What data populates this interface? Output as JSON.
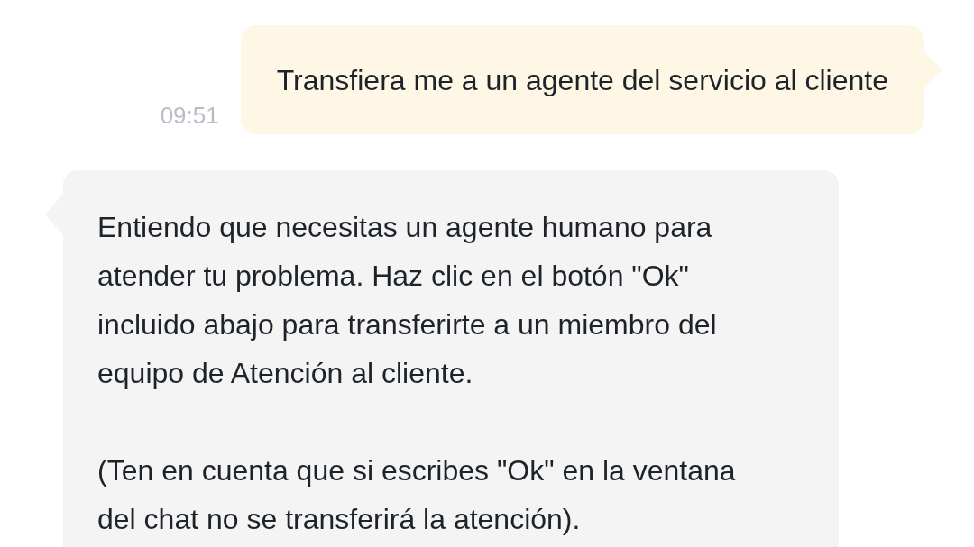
{
  "messages": [
    {
      "kind": "outgoing",
      "time": "09:51",
      "paragraphs": [
        [
          "Transfiera me a un agente del servicio al cliente"
        ]
      ]
    },
    {
      "kind": "incoming",
      "paragraphs": [
        [
          "Entiendo que necesitas un agente humano para",
          "atender tu problema. Haz clic en el botón \"Ok\"",
          "incluido abajo para transferirte a un miembro del",
          "equipo de Atención al cliente."
        ],
        [
          "(Ten en cuenta que si escribes \"Ok\" en la ventana",
          "del chat no se transferirá la atención)."
        ]
      ]
    }
  ]
}
